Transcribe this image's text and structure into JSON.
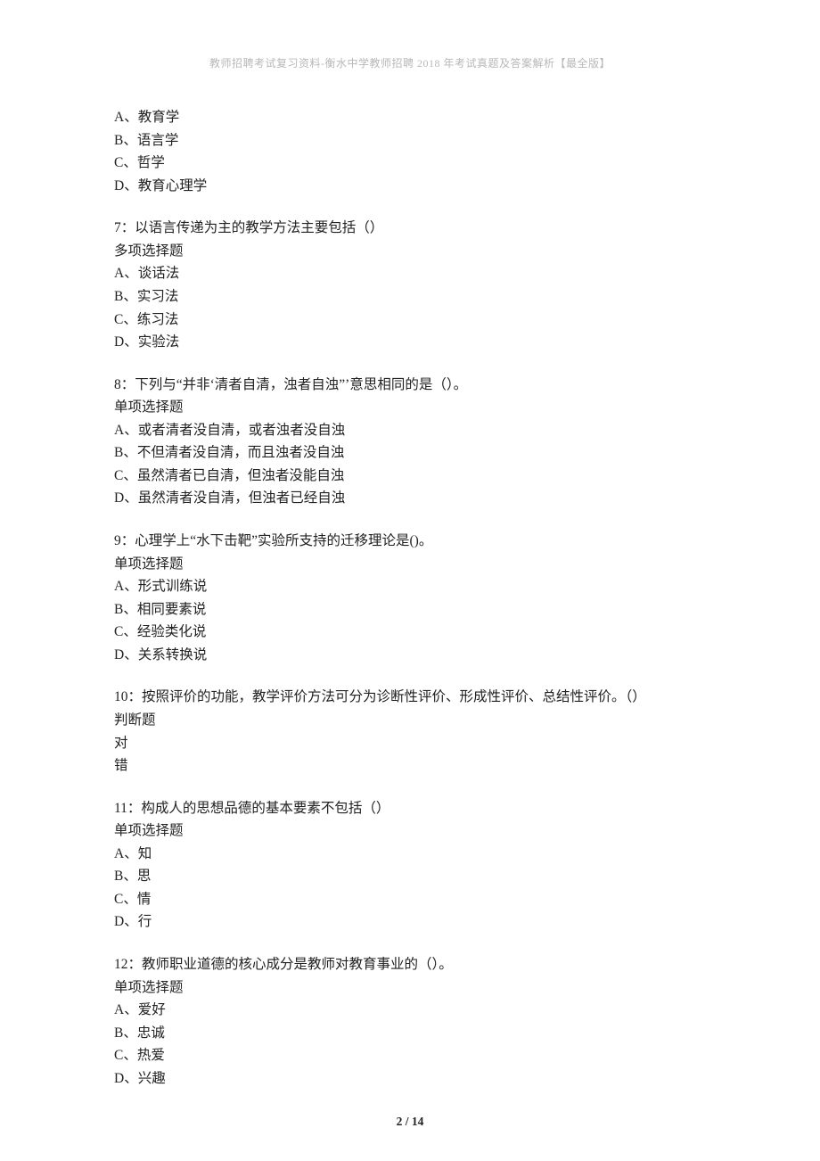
{
  "header": "教师招聘考试复习资料-衡水中学教师招聘 2018 年考试真题及答案解析【最全版】",
  "footer": "2 / 14",
  "q6": {
    "optA": "A、教育学",
    "optB": "B、语言学",
    "optC": "C、哲学",
    "optD": "D、教育心理学"
  },
  "q7": {
    "stem": "7：以语言传递为主的教学方法主要包括（）",
    "type": "多项选择题",
    "optA": "A、谈话法",
    "optB": "B、实习法",
    "optC": "C、练习法",
    "optD": "D、实验法"
  },
  "q8": {
    "stem": "8：下列与“并非‘清者自清，浊者自浊”’意思相同的是（）。",
    "type": "单项选择题",
    "optA": "A、或者清者没自清，或者浊者没自浊",
    "optB": "B、不但清者没自清，而且浊者没自浊",
    "optC": "C、虽然清者已自清，但浊者没能自浊",
    "optD": "D、虽然清者没自清，但浊者已经自浊"
  },
  "q9": {
    "stem": "9：心理学上“水下击靶”实验所支持的迁移理论是()。",
    "type": "单项选择题",
    "optA": "A、形式训练说",
    "optB": "B、相同要素说",
    "optC": "C、经验类化说",
    "optD": "D、关系转换说"
  },
  "q10": {
    "stem": "10：按照评价的功能，教学评价方法可分为诊断性评价、形成性评价、总结性评价。（）",
    "type": "判断题",
    "optA": "对",
    "optB": "错"
  },
  "q11": {
    "stem": "11：构成人的思想品德的基本要素不包括（）",
    "type": "单项选择题",
    "optA": "A、知",
    "optB": "B、思",
    "optC": "C、情",
    "optD": "D、行"
  },
  "q12": {
    "stem": "12：教师职业道德的核心成分是教师对教育事业的（）。",
    "type": "单项选择题",
    "optA": "A、爱好",
    "optB": "B、忠诚",
    "optC": "C、热爱",
    "optD": "D、兴趣"
  }
}
